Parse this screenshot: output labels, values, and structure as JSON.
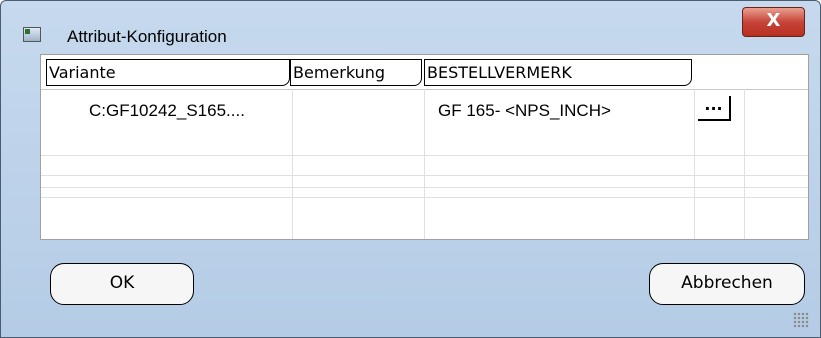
{
  "window": {
    "title": "Attribut-Konfiguration",
    "close_label": "X"
  },
  "grid": {
    "columns": [
      "Variante",
      "Bemerkung",
      "BESTELLVERMERK"
    ],
    "rows": [
      {
        "variante": "C:GF10242_S165....",
        "bemerkung": "",
        "bestellvermerk": "GF 165- <NPS_INCH>",
        "action": "..."
      }
    ]
  },
  "buttons": {
    "ok": "OK",
    "cancel": "Abbrechen"
  }
}
